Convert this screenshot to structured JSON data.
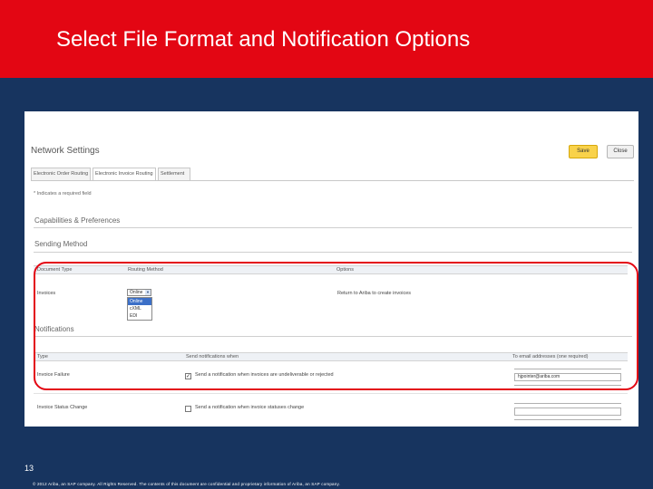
{
  "slide": {
    "title": "Select File Format and Notification Options",
    "number": "13",
    "footer": "© 2012 Ariba, an SAP company. All Rights Reserved. The contents of this document are confidential and proprietary information of Ariba, an SAP company."
  },
  "app": {
    "page_title": "Network Settings",
    "save_label": "Save",
    "close_label": "Close",
    "tabs": [
      {
        "label": "Electronic Order Routing"
      },
      {
        "label": "Electronic Invoice Routing"
      },
      {
        "label": "Settlement"
      }
    ],
    "required_note": "* Indicates a required field",
    "capabilities_label": "Capabilities & Preferences",
    "sending_method_label": "Sending Method",
    "sending_table": {
      "headers": [
        "Document Type",
        "Routing Method",
        "Options"
      ],
      "row": {
        "doc_type": "Invoices",
        "routing_selected": "Online",
        "options": "Return to Ariba to create invoices"
      },
      "routing_options": [
        "Online",
        "cXML",
        "EDI"
      ]
    },
    "notifications_label": "Notifications",
    "notif_table": {
      "headers": [
        "Type",
        "Send notifications when",
        "To email addresses (one required)"
      ],
      "rows": [
        {
          "type": "Invoice Failure",
          "checked": true,
          "check_mark": "✓",
          "condition": "Send a notification when invoices are undeliverable or rejected",
          "email": "hjpointer@ariba.com"
        },
        {
          "type": "Invoice Status Change",
          "checked": false,
          "check_mark": "",
          "condition": "Send a notification when invoice statuses change",
          "email": ""
        }
      ]
    }
  },
  "colors": {
    "header_red": "#e30613",
    "background_blue": "#17345f",
    "save_yellow": "#f9d24a",
    "highlight_red": "#e30613"
  }
}
